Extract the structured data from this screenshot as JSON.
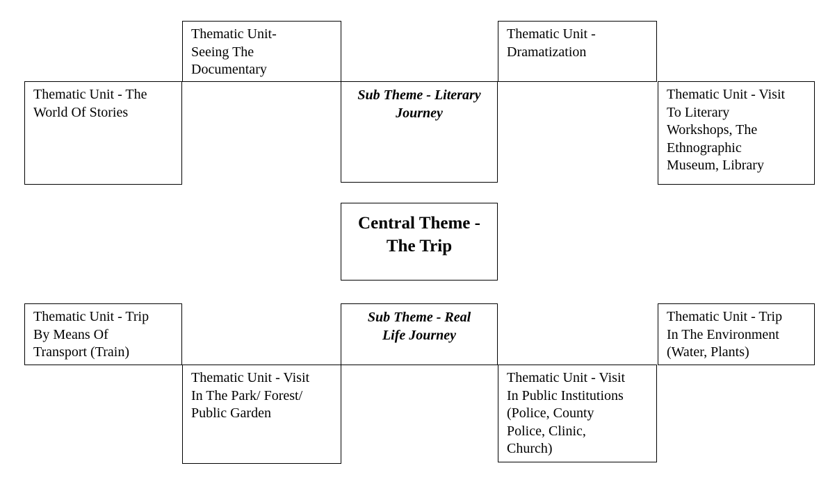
{
  "diagram": {
    "title": "Central Theme - The Trip concept map",
    "style": {
      "border_color": "#000000",
      "background_color": "#ffffff",
      "text_color": "#000000"
    },
    "nodes": [
      {
        "id": "documentary",
        "kind": "thematic-unit",
        "label": "Thematic Unit-\nSeeing The\nDocumentary"
      },
      {
        "id": "dramatization",
        "kind": "thematic-unit",
        "label": "Thematic Unit -\nDramatization"
      },
      {
        "id": "world-stories",
        "kind": "thematic-unit",
        "label": "Thematic Unit - The\nWorld Of Stories"
      },
      {
        "id": "literary-journey",
        "kind": "sub-theme",
        "label": "Sub Theme - Literary\nJourney"
      },
      {
        "id": "literary-visit",
        "kind": "thematic-unit",
        "label": "Thematic Unit - Visit\nTo Literary\nWorkshops, The\nEthnographic\nMuseum, Library"
      },
      {
        "id": "central",
        "kind": "central-theme",
        "label": "Central Theme -\nThe Trip"
      },
      {
        "id": "transport",
        "kind": "thematic-unit",
        "label": "Thematic Unit - Trip\nBy Means Of\nTransport (Train)"
      },
      {
        "id": "real-life",
        "kind": "sub-theme",
        "label": "Sub Theme - Real\nLife Journey"
      },
      {
        "id": "environment",
        "kind": "thematic-unit",
        "label": "Thematic Unit - Trip\nIn The Environment\n(Water, Plants)"
      },
      {
        "id": "park-forest",
        "kind": "thematic-unit",
        "label": "Thematic Unit - Visit\nIn The Park/ Forest/\nPublic Garden"
      },
      {
        "id": "public-inst",
        "kind": "thematic-unit",
        "label": "Thematic Unit - Visit\nIn  Public Institutions\n(Police,  County\nPolice, Clinic,\nChurch)"
      }
    ]
  }
}
